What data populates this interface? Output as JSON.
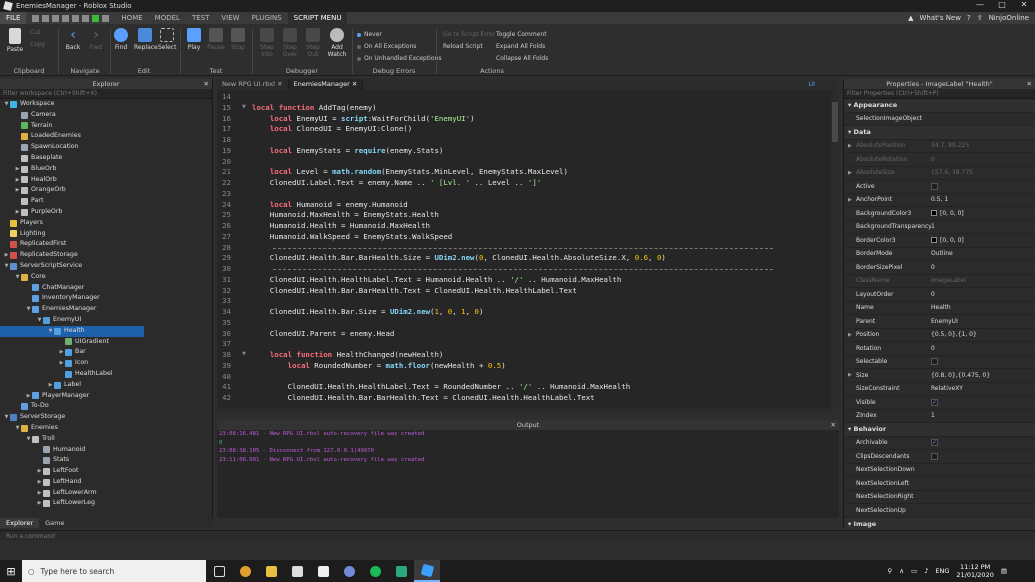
{
  "window": {
    "title": "EnemiesManager - Roblox Studio",
    "controls": [
      "—",
      "□",
      "✕"
    ]
  },
  "menubar": {
    "file": "FILE",
    "tabs": [
      "HOME",
      "MODEL",
      "TEST",
      "VIEW",
      "PLUGINS",
      "SCRIPT MENU"
    ],
    "active_tab": "SCRIPT MENU",
    "whats_new": "What's New",
    "user": "NinjoOnline"
  },
  "ribbon": {
    "paste": "Paste",
    "cut": "Cut",
    "copy": "Copy",
    "back": "Back",
    "fwd": "Fwd",
    "find": "Find",
    "replace": "Replace",
    "select": "Select",
    "play": "Play",
    "pause": "Pause",
    "stop": "Stop",
    "step_into": "Step Into",
    "step_over": "Step Over",
    "step_out": "Step Out",
    "add_watch": "Add Watch",
    "never": "Never",
    "on_all_exceptions": "On All Exceptions",
    "on_unhandled": "On Unhandled Exceptions",
    "go_to_error": "Go to Script Error",
    "reload_script": "Reload Script",
    "toggle_comment": "Toggle Comment",
    "expand_all": "Expand All Folds",
    "collapse_all": "Collapse All Folds",
    "groups": {
      "clipboard": "Clipboard",
      "navigate": "Navigate",
      "edit": "Edit",
      "test": "Test",
      "debugger": "Debugger",
      "debug_errors": "Debug Errors",
      "actions": "Actions"
    }
  },
  "explorer": {
    "title": "Explorer",
    "filter_placeholder": "Filter workspace (Ctrl+Shift+X)",
    "items": [
      {
        "label": "Workspace",
        "indent": 0,
        "arrow": "▼",
        "color": "#3fb3e8"
      },
      {
        "label": "Camera",
        "indent": 1,
        "arrow": "",
        "color": "#9aa4b0"
      },
      {
        "label": "Terrain",
        "indent": 1,
        "arrow": "",
        "color": "#5cb85c"
      },
      {
        "label": "LoadedEnemies",
        "indent": 1,
        "arrow": "",
        "color": "#e0b040"
      },
      {
        "label": "SpawnLocation",
        "indent": 1,
        "arrow": "",
        "color": "#9aa4b0"
      },
      {
        "label": "Baseplate",
        "indent": 1,
        "arrow": "",
        "color": "#c0c0c0"
      },
      {
        "label": "BlueOrb",
        "indent": 1,
        "arrow": "▶",
        "color": "#c0c0c0"
      },
      {
        "label": "HealOrb",
        "indent": 1,
        "arrow": "▶",
        "color": "#c0c0c0"
      },
      {
        "label": "OrangeOrb",
        "indent": 1,
        "arrow": "▶",
        "color": "#c0c0c0"
      },
      {
        "label": "Part",
        "indent": 1,
        "arrow": "",
        "color": "#c0c0c0"
      },
      {
        "label": "PurpleOrb",
        "indent": 1,
        "arrow": "▶",
        "color": "#c0c0c0"
      },
      {
        "label": "Players",
        "indent": 0,
        "arrow": "",
        "color": "#e8c040"
      },
      {
        "label": "Lighting",
        "indent": 0,
        "arrow": "",
        "color": "#f0d060"
      },
      {
        "label": "ReplicatedFirst",
        "indent": 0,
        "arrow": "",
        "color": "#d05050"
      },
      {
        "label": "ReplicatedStorage",
        "indent": 0,
        "arrow": "▶",
        "color": "#d05050"
      },
      {
        "label": "ServerScriptService",
        "indent": 0,
        "arrow": "▼",
        "color": "#6090d0"
      },
      {
        "label": "Core",
        "indent": 1,
        "arrow": "▼",
        "color": "#e0b040"
      },
      {
        "label": "ChatManager",
        "indent": 2,
        "arrow": "",
        "color": "#60a0e0"
      },
      {
        "label": "InventoryManager",
        "indent": 2,
        "arrow": "",
        "color": "#60a0e0"
      },
      {
        "label": "EnemiesManager",
        "indent": 2,
        "arrow": "▼",
        "color": "#60a0e0"
      },
      {
        "label": "EnemyUI",
        "indent": 3,
        "arrow": "▼",
        "color": "#50a0e0"
      },
      {
        "label": "Health",
        "indent": 4,
        "arrow": "▼",
        "color": "#50a0e0",
        "selected": true
      },
      {
        "label": "UIGradient",
        "indent": 5,
        "arrow": "",
        "color": "#70b070"
      },
      {
        "label": "Bar",
        "indent": 5,
        "arrow": "▶",
        "color": "#50a0e0"
      },
      {
        "label": "Icon",
        "indent": 5,
        "arrow": "▶",
        "color": "#50a0e0"
      },
      {
        "label": "HealthLabel",
        "indent": 5,
        "arrow": "",
        "color": "#50a0e0"
      },
      {
        "label": "Label",
        "indent": 4,
        "arrow": "▶",
        "color": "#50a0e0"
      },
      {
        "label": "PlayerManager",
        "indent": 2,
        "arrow": "▶",
        "color": "#60a0e0"
      },
      {
        "label": "To-Do",
        "indent": 1,
        "arrow": "",
        "color": "#60a0e0"
      },
      {
        "label": "ServerStorage",
        "indent": 0,
        "arrow": "▼",
        "color": "#5080c0"
      },
      {
        "label": "Enemies",
        "indent": 1,
        "arrow": "▼",
        "color": "#e0b040"
      },
      {
        "label": "Troll",
        "indent": 2,
        "arrow": "▼",
        "color": "#c0c0c0"
      },
      {
        "label": "Humanoid",
        "indent": 3,
        "arrow": "",
        "color": "#9aa4b0"
      },
      {
        "label": "Stats",
        "indent": 3,
        "arrow": "",
        "color": "#9aa4b0"
      },
      {
        "label": "LeftFoot",
        "indent": 3,
        "arrow": "▶",
        "color": "#c0c0c0"
      },
      {
        "label": "LeftHand",
        "indent": 3,
        "arrow": "▶",
        "color": "#c0c0c0"
      },
      {
        "label": "LeftLowerArm",
        "indent": 3,
        "arrow": "▶",
        "color": "#c0c0c0"
      },
      {
        "label": "LeftLowerLeg",
        "indent": 3,
        "arrow": "▶",
        "color": "#c0c0c0"
      }
    ],
    "bottom_tabs": [
      "Explorer",
      "Game"
    ]
  },
  "editor": {
    "tabs": [
      "New RPG UI.rbxl",
      "EnemiesManager"
    ],
    "active_tab": "EnemiesManager",
    "ui_label": "UI",
    "lines": [
      {
        "n": "14",
        "code": ""
      },
      {
        "n": "15",
        "code": "local function AddTag(enemy)",
        "fold": true
      },
      {
        "n": "16",
        "code": "    local EnemyUI = script:WaitForChild('EnemyUI')"
      },
      {
        "n": "17",
        "code": "    local ClonedUI = EnemyUI:Clone()"
      },
      {
        "n": "18",
        "code": ""
      },
      {
        "n": "19",
        "code": "    local EnemyStats = require(enemy.Stats)"
      },
      {
        "n": "20",
        "code": ""
      },
      {
        "n": "21",
        "code": "    local Level = math.random(EnemyStats.MinLevel, EnemyStats.MaxLevel)"
      },
      {
        "n": "22",
        "code": "    ClonedUI.Label.Text = enemy.Name .. ' [Lvl. ' .. Level .. ']'"
      },
      {
        "n": "23",
        "code": ""
      },
      {
        "n": "24",
        "code": "    local Humanoid = enemy.Humanoid"
      },
      {
        "n": "25",
        "code": "    Humanoid.MaxHealth = EnemyStats.Health"
      },
      {
        "n": "26",
        "code": "    Humanoid.Health = Humanoid.MaxHealth"
      },
      {
        "n": "27",
        "code": "    Humanoid.WalkSpeed = EnemyStats.WalkSpeed"
      },
      {
        "n": "28",
        "code": "",
        "dashed": true
      },
      {
        "n": "29",
        "code": "    ClonedUI.Health.Bar.BarHealth.Size = UDim2.new(0, ClonedUI.Health.AbsoluteSize.X, 0.6, 0)"
      },
      {
        "n": "30",
        "code": "",
        "dashed": true
      },
      {
        "n": "31",
        "code": "    ClonedUI.Health.HealthLabel.Text = Humanoid.Health .. '/' .. Humanoid.MaxHealth"
      },
      {
        "n": "32",
        "code": "    ClonedUI.Health.Bar.BarHealth.Text = ClonedUI.Health.HealthLabel.Text"
      },
      {
        "n": "33",
        "code": ""
      },
      {
        "n": "34",
        "code": "    ClonedUI.Health.Bar.Size = UDim2.new(1, 0, 1, 0)"
      },
      {
        "n": "35",
        "code": ""
      },
      {
        "n": "36",
        "code": "    ClonedUI.Parent = enemy.Head"
      },
      {
        "n": "37",
        "code": ""
      },
      {
        "n": "38",
        "code": "    local function HealthChanged(newHealth)",
        "fold": true
      },
      {
        "n": "39",
        "code": "        local RoundedNumber = math.floor(newHealth + 0.5)"
      },
      {
        "n": "40",
        "code": ""
      },
      {
        "n": "41",
        "code": "        ClonedUI.Health.HealthLabel.Text = RoundedNumber .. '/' .. Humanoid.MaxHealth"
      },
      {
        "n": "42",
        "code": "        ClonedUI.Health.Bar.BarHealth.Text = ClonedUI.Health.HealthLabel.Text"
      }
    ]
  },
  "output": {
    "title": "Output",
    "lines": [
      {
        "text": "23:08:16.481 - New RPG UI.rbxl auto-recovery file was created",
        "color": "#c05ad8"
      },
      {
        "text": "0",
        "color": "#3cb371"
      },
      {
        "text": "23:08:38.105 - Disconnect from 127.0.0.1|49970",
        "color": "#c05ad8"
      },
      {
        "text": "23:11:08.081 - New RPG UI.rbxl auto-recovery file was created",
        "color": "#c05ad8"
      }
    ]
  },
  "properties": {
    "title": "Properties - ImageLabel \"Health\"",
    "filter_placeholder": "Filter Properties (Ctrl+Shift+P)",
    "rows": [
      {
        "type": "cat",
        "label": "Appearance"
      },
      {
        "name": "SelectionImageObject",
        "value": ""
      },
      {
        "type": "cat",
        "label": "Data"
      },
      {
        "name": "AbsolutePosition",
        "value": "94.7, 89.225",
        "dim": true,
        "arrow": true
      },
      {
        "name": "AbsoluteRotation",
        "value": "0",
        "dim": true
      },
      {
        "name": "AbsoluteSize",
        "value": "157.6, 38.775",
        "dim": true,
        "arrow": true
      },
      {
        "name": "Active",
        "value": "",
        "check": false
      },
      {
        "name": "AnchorPoint",
        "value": "0.5, 1",
        "arrow": true
      },
      {
        "name": "BackgroundColor3",
        "value": "[0, 0, 0]",
        "swatch": true
      },
      {
        "name": "BackgroundTransparency",
        "value": "1"
      },
      {
        "name": "BorderColor3",
        "value": "[0, 0, 0]",
        "swatch": true
      },
      {
        "name": "BorderMode",
        "value": "Outline"
      },
      {
        "name": "BorderSizePixel",
        "value": "0"
      },
      {
        "name": "ClassName",
        "value": "ImageLabel",
        "dim": true
      },
      {
        "name": "LayoutOrder",
        "value": "0"
      },
      {
        "name": "Name",
        "value": "Health"
      },
      {
        "name": "Parent",
        "value": "EnemyUI"
      },
      {
        "name": "Position",
        "value": "{0.5, 0},{1, 0}",
        "arrow": true
      },
      {
        "name": "Rotation",
        "value": "0"
      },
      {
        "name": "Selectable",
        "value": "",
        "check": false
      },
      {
        "name": "Size",
        "value": "{0.8, 0},{0.475, 0}",
        "arrow": true
      },
      {
        "name": "SizeConstraint",
        "value": "RelativeXY"
      },
      {
        "name": "Visible",
        "value": "",
        "check": true
      },
      {
        "name": "ZIndex",
        "value": "1"
      },
      {
        "type": "cat",
        "label": "Behavior"
      },
      {
        "name": "Archivable",
        "value": "",
        "check": true
      },
      {
        "name": "ClipsDescendants",
        "value": "",
        "check": false
      },
      {
        "name": "NextSelectionDown",
        "value": ""
      },
      {
        "name": "NextSelectionLeft",
        "value": ""
      },
      {
        "name": "NextSelectionRight",
        "value": ""
      },
      {
        "name": "NextSelectionUp",
        "value": ""
      },
      {
        "type": "cat",
        "label": "Image"
      }
    ]
  },
  "command_bar": {
    "placeholder": "Run a command"
  },
  "taskbar": {
    "search_placeholder": "Type here to search",
    "lang": "ENG",
    "time": "11:12 PM",
    "date": "21/01/2020"
  }
}
